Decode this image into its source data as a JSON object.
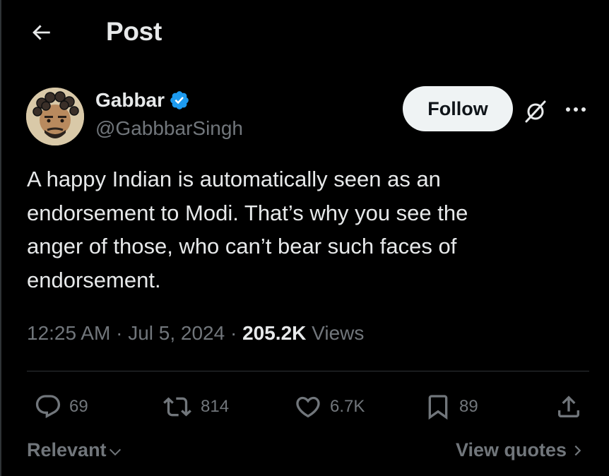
{
  "header": {
    "title": "Post",
    "back_icon": "arrow-left-icon"
  },
  "author": {
    "name": "Gabbar",
    "handle": "@GabbbarSingh",
    "verified": true,
    "verified_color": "#1d9bf0"
  },
  "follow_label": "Follow",
  "tweet": {
    "text": "A happy Indian is automatically seen as an\nendorsement to Modi. That’s why you see the\nanger of those, who can’t bear such faces of\nendorsement."
  },
  "meta": {
    "time": "12:25 AM",
    "separator1": " · ",
    "date": "Jul 5, 2024",
    "separator2": " · ",
    "views_count": "205.2K",
    "views_label": "Views"
  },
  "actions": {
    "replies": "69",
    "reposts": "814",
    "likes": "6.7K",
    "bookmarks": "89"
  },
  "footer": {
    "sort_label": "Relevant",
    "view_quotes_label": "View quotes"
  },
  "colors": {
    "background": "#000000",
    "text": "#e7e9ea",
    "muted": "#71767b",
    "accent": "#1d9bf0"
  }
}
